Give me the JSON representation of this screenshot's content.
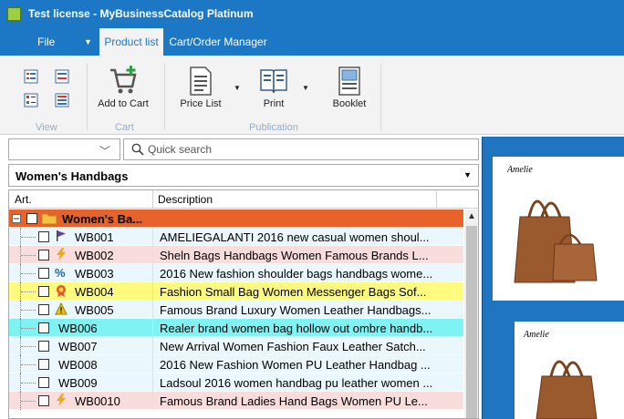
{
  "window": {
    "title": "Test license - MyBusinessCatalog Platinum"
  },
  "menu": {
    "file": "File",
    "tabs": [
      "Product list",
      "Cart/Order Manager"
    ]
  },
  "ribbon": {
    "groups": {
      "view": "View",
      "cart": "Cart",
      "publication": "Publication"
    },
    "buttons": {
      "add_to_cart": "Add to Cart",
      "price_list": "Price List",
      "print": "Print",
      "booklet": "Booklet"
    }
  },
  "filter": {
    "combo_value": "",
    "search_placeholder": "Quick search"
  },
  "category": {
    "selected": "Women's Handbags"
  },
  "grid": {
    "columns": [
      "Art.",
      "Description"
    ],
    "group_label": "Women's Ba...",
    "rows": [
      {
        "code": "WB001",
        "desc": "AMELIEGALANTI 2016 new casual women shoul...",
        "bg": "#eaf7fd",
        "icon": "flag-icon"
      },
      {
        "code": "WB002",
        "desc": "Sheln Bags Handbags Women Famous Brands L...",
        "bg": "#f9dcdc",
        "icon": "lightning-icon"
      },
      {
        "code": "WB003",
        "desc": "2016 New fashion shoulder bags handbags wome...",
        "bg": "#eaf7fd",
        "icon": "percent-icon"
      },
      {
        "code": "WB004",
        "desc": "Fashion Small Bag Women Messenger Bags Sof...",
        "bg": "#fffb7e",
        "icon": "award-icon"
      },
      {
        "code": "WB005",
        "desc": "Famous Brand Luxury Women Leather Handbags...",
        "bg": "#eaf7fd",
        "icon": "warning-icon"
      },
      {
        "code": "WB006",
        "desc": "Realer brand women bag hollow out ombre handb...",
        "bg": "#7ff3f3",
        "icon": ""
      },
      {
        "code": "WB007",
        "desc": "New Arrival Women Fashion Faux Leather Satch...",
        "bg": "#eaf7fd",
        "icon": ""
      },
      {
        "code": "WB008",
        "desc": "2016 New Fashion Women PU Leather Handbag ...",
        "bg": "#eaf7fd",
        "icon": ""
      },
      {
        "code": "WB009",
        "desc": "Ladsoul 2016 women handbag pu leather women ...",
        "bg": "#eaf7fd",
        "icon": ""
      },
      {
        "code": "WB0010",
        "desc": "Famous Brand Ladies Hand Bags Women PU Le...",
        "bg": "#f9dcdc",
        "icon": "lightning-icon"
      }
    ]
  },
  "preview": {
    "brand_text": "Amelie"
  },
  "colors": {
    "accent": "#1c77c4",
    "group_row": "#e8622b"
  }
}
